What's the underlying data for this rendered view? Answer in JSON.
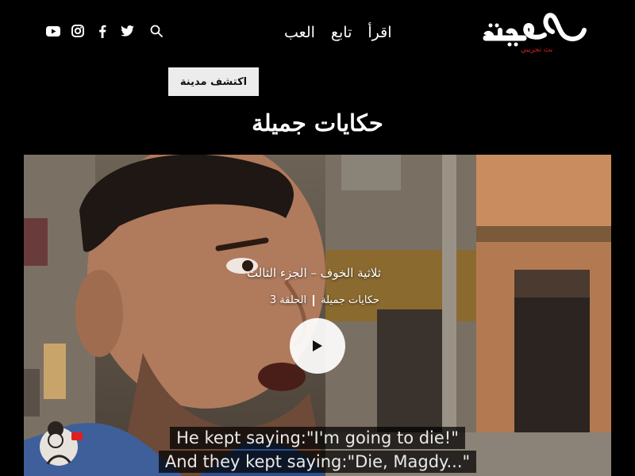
{
  "header": {
    "logo_text": "مدينة",
    "logo_subtext": "بث تجريبي",
    "nav": [
      {
        "label": "اقرأ"
      },
      {
        "label": "تابع"
      },
      {
        "label": "العب"
      }
    ],
    "social_icons": [
      "youtube-icon",
      "instagram-icon",
      "facebook-icon",
      "twitter-icon",
      "search-icon"
    ]
  },
  "discover_button": "اكتشف مدينة",
  "page_title": "حكايات جميلة",
  "video": {
    "episode_title": "ثلاثية الخوف – الجزء الثالث",
    "series": "حكايات جميلة",
    "episode": "الحلقة 3",
    "subtitle_line1": "He kept saying:\"I'm going to die!\"",
    "subtitle_line2": "And they kept saying:\"Die, Magdy...\""
  },
  "colors": {
    "background": "#000000",
    "accent_red": "#e0201f",
    "button_bg": "#ececec"
  }
}
